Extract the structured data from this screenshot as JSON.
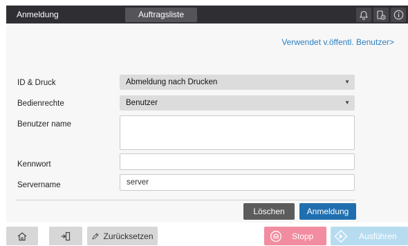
{
  "header": {
    "title": "Anmeldung",
    "tab_label": "Auftragsliste",
    "icons": [
      "bell-icon",
      "device-icon",
      "info-icon"
    ]
  },
  "main": {
    "public_user_link": "Verwendet v.öffentl. Benutzer>",
    "fields": {
      "id_print": {
        "label": "ID & Druck",
        "value": "Abmeldung nach Drucken"
      },
      "permissions": {
        "label": "Bedienrechte",
        "value": "Benutzer"
      },
      "username": {
        "label": "Benutzer name",
        "value": ""
      },
      "password": {
        "label": "Kennwort",
        "value": ""
      },
      "servername": {
        "label": "Servername",
        "value": "server"
      }
    },
    "clear_button": "Löschen",
    "login_button": "Anmeldung"
  },
  "footer": {
    "reset_label": "Zurücksetzen",
    "stop_label": "Stopp",
    "start_label": "Ausführen"
  },
  "colors": {
    "accent_blue": "#1f6fb0",
    "link_blue": "#2a7fc1",
    "stop_pink": "#f28ca0",
    "start_lightblue": "#b7dcf0"
  }
}
